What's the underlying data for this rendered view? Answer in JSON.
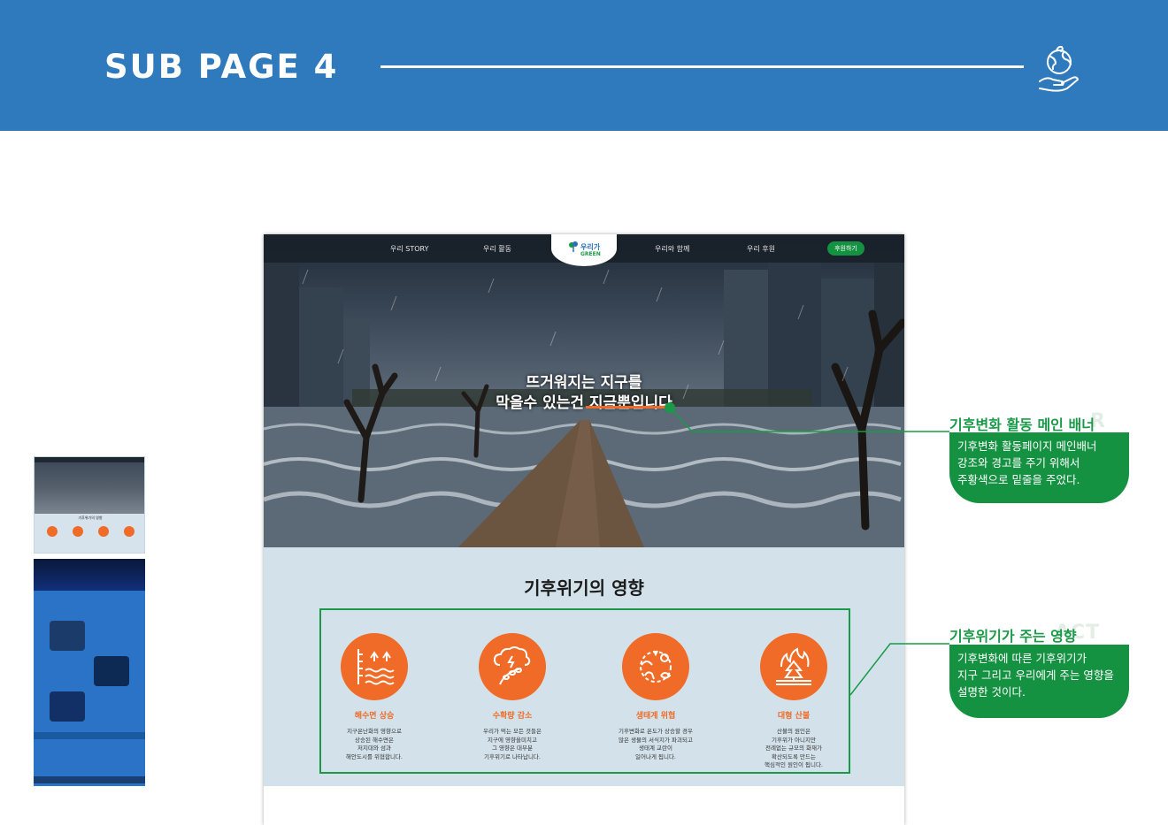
{
  "header": {
    "title": "SUB PAGE 4",
    "icon": "earth-in-hand-icon"
  },
  "site": {
    "nav": [
      "우리 STORY",
      "우리 활동",
      "우리와 함께",
      "우리 후원"
    ],
    "logo_top": "우리가",
    "logo_bottom": "GREEN",
    "donate_label": "후원하기",
    "hero_line1": "뜨거워지는 지구를",
    "hero_line2": "막을수 있는건 지금뿐입니다",
    "impact_title": "기후위기의 영향",
    "impacts": [
      {
        "name": "해수면 상승",
        "icon": "sea-level-icon",
        "desc": "지구온난화의 영향으로\n상승된 해수면은\n저지대와 섬과\n해안도시를 위협합니다."
      },
      {
        "name": "수확량 감소",
        "icon": "crop-storm-icon",
        "desc": "우리가 먹는 모든 것들은\n지구에 영향을미치고\n그 영향은 대부분\n기후위기로 나타납니다."
      },
      {
        "name": "생태계 위협",
        "icon": "ecosystem-icon",
        "desc": "기후변화로 온도가 상승할 경우\n많은 생물의 서식지가 파괴되고\n생태계 교란이\n일어나게 됩니다."
      },
      {
        "name": "대형 산불",
        "icon": "wildfire-icon",
        "desc": "산불의 원인은\n기후위가 아니지만\n전례없는 규모의 화재가\n확산되도록 만드는\n핵심적인 원인이 됩니다."
      }
    ]
  },
  "annotations": [
    {
      "title": "기후변화 활동 메인 배너",
      "ghost": "R",
      "text": "기후변화 활동페이지 메인배너\n강조와 경고를 주기 위해서\n주황색으로 밑줄을 주었다."
    },
    {
      "title": "기후위기가 주는 영향",
      "ghost": "ACT",
      "text": "기후변화에 따른 기후위기가\n지구 그리고 우리에게 주는 영향을\n설명한 것이다."
    }
  ],
  "colors": {
    "brand_blue": "#2f79bd",
    "accent_orange": "#ef6b27",
    "green": "#1a9a48"
  }
}
